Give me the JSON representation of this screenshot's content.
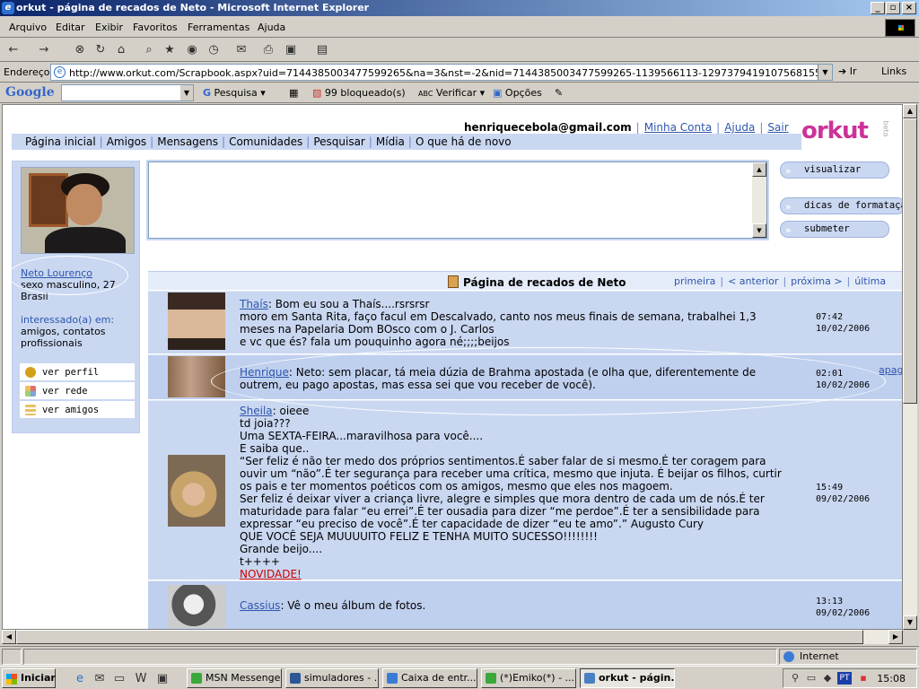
{
  "window": {
    "title": "orkut - página de recados de Neto - Microsoft Internet Explorer",
    "controls": [
      "_",
      "▫",
      "×"
    ]
  },
  "menu": [
    "Arquivo",
    "Editar",
    "Exibir",
    "Favoritos",
    "Ferramentas",
    "Ajuda"
  ],
  "address": {
    "label": "Endereço",
    "url": "http://www.orkut.com/Scrapbook.aspx?uid=7144385003477599265&na=3&nst=-2&nid=7144385003477599265-1139566113-1297379419107568155O",
    "go": "Ir",
    "links": "Links"
  },
  "google_bar": {
    "logo": "Google",
    "search": "Pesquisa",
    "blocked": "99 bloqueado(s)",
    "check": "Verificar",
    "options": "Opções"
  },
  "page": {
    "user_email": "henriquecebola@gmail.com",
    "top_links": [
      "Minha Conta",
      "Ajuda",
      "Sair"
    ],
    "logo": "orkut",
    "beta": "beta",
    "nav": [
      "Página inicial",
      "Amigos",
      "Mensagens",
      "Comunidades",
      "Pesquisar",
      "Mídia",
      "O que há de novo"
    ],
    "profile": {
      "name": "Neto Lourenço",
      "info": "sexo masculino, 27\nBrasil",
      "interest_label": "interessado(a) em:",
      "interest": "amigos, contatos profissionais"
    },
    "side_menu": [
      {
        "label": "ver perfil",
        "icon": "person-icon",
        "color": "#d4a017"
      },
      {
        "label": "ver rede",
        "icon": "network-icon",
        "color": "#7fa6d8"
      },
      {
        "label": "ver amigos",
        "icon": "friends-icon",
        "color": "#e8c060"
      }
    ],
    "buttons": {
      "preview": "visualizar",
      "tips": "dicas de formatação",
      "submit": "submeter"
    },
    "scrapbook": {
      "title": "Página de recados de Neto",
      "pager": [
        "primeira",
        "< anterior",
        "próxima >",
        "última"
      ]
    },
    "scraps": [
      {
        "author": "Thaís",
        "text": ": Bom eu sou a Thaís....rsrsrsr\nmoro em Santa Rita, faço facul em Descalvado, canto nos meus finais de semana, trabalhei 1,3\nmeses na Papelaria Dom BOsco com o J. Carlos\ne vc que és? fala um pouquinho agora né;;;;beijos",
        "time": "07:42",
        "date": "10/02/2006"
      },
      {
        "author": "Henrique",
        "text": ": Neto: sem placar, tá meia dúzia de Brahma apostada (e olha que, diferentemente de\noutrem, eu pago apostas, mas essa sei que vou receber de você).",
        "time": "02:01",
        "date": "10/02/2006",
        "action": "apagar"
      },
      {
        "author": "Sheila",
        "text": ": oieee\ntd joia???\nUma SEXTA-FEIRA...maravilhosa para você....\nE saiba que..\n“Ser feliz é não ter medo dos próprios sentimentos.É saber falar de si mesmo.É ter coragem para\nouvir um “não”.É ter segurança para receber uma crítica, mesmo que injuta. É beijar os filhos, curtir\nos pais e ter momentos poéticos com os amigos, mesmo que eles nos magoem.\nSer feliz é deixar viver a criança livre, alegre e simples que mora dentro de cada um de nós.É ter\nmaturidade para falar “eu errei”.É ter ousadia para dizer “me perdoe”.É ter a sensibilidade para\nexpressar “eu preciso de você”.É ter capacidade de dizer “eu te amo”.” Augusto Cury\nQUE VOCÊ SEJA MUUUUITO FELIZ E TENHA MUITO SUCESSO!!!!!!!!\nGrande beijo....\nt++++",
        "link": "NOVIDADE!",
        "time": "15:49",
        "date": "09/02/2006"
      },
      {
        "author": "Cassius",
        "text": ": Vê o meu álbum de fotos.",
        "time": "13:13",
        "date": "09/02/2006"
      }
    ]
  },
  "status": {
    "zone": "Internet"
  },
  "taskbar": {
    "start": "Iniciar",
    "tasks": [
      "MSN Messenger",
      "simuladores - ...",
      "Caixa de entr...",
      "(*)Emiko(*) - ...",
      "orkut - págin..."
    ],
    "lang": "PT",
    "clock": "15:08"
  },
  "colors": {
    "orkut_blue": "#c9d7f1",
    "orkut_pink": "#cc3399",
    "link": "#2d56ac"
  }
}
